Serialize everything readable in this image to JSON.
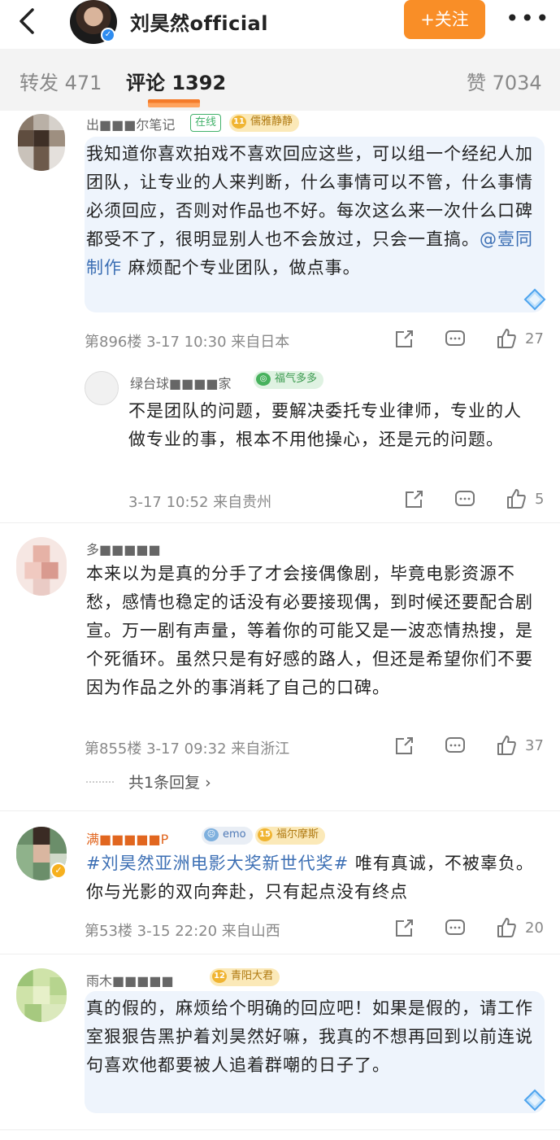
{
  "header": {
    "account_name": "刘昊然official",
    "follow_label": "+关注",
    "more_label": "•••"
  },
  "tabs": {
    "repost": "转发 471",
    "comments": "评论 1392",
    "likes": "赞 7034"
  },
  "comments": [
    {
      "username": "出■■■尔笔记",
      "online_label": "在线",
      "badge": {
        "icon": "11",
        "label": "儒雅静静"
      },
      "text_before": "我知道你喜欢拍戏不喜欢回应这些，可以组一个经纪人加团队，让专业的人来判断，什么事情可以不管，什么事情必须回应，否则对作品也不好。每次这么来一次什么口碑都受不了，很明显别人也不会放过，只会一直搞。",
      "mention": "@壹同制作",
      "text_after": " 麻烦配个专业团队，做点事。",
      "floor_time_loc": "第896楼 3-17 10:30 来自日本",
      "likes": "27",
      "reply": {
        "username": "绿台球■■■■家",
        "badge": {
          "icon": "◎",
          "label": "福气多多"
        },
        "text": "不是团队的问题，要解决委托专业律师，专业的人做专业的事，根本不用他操心，还是元的问题。",
        "time_loc": "3-17 10:52 来自贵州",
        "likes": "5"
      }
    },
    {
      "username": "多■■■■■",
      "text": "本来以为是真的分手了才会接偶像剧，毕竟电影资源不愁，感情也稳定的话没有必要接现偶，到时候还要配合剧宣。万一剧有声量，等着你的可能又是一波恋情热搜，是个死循环。虽然只是有好感的路人，但还是希望你们不要因为作品之外的事消耗了自己的口碑。",
      "floor_time_loc": "第855楼 3-17 09:32 来自浙江",
      "likes": "37",
      "replies_link": "共1条回复 ›"
    },
    {
      "username": "满■■■■■P",
      "emo_badge": "emo",
      "badge": {
        "icon": "15",
        "label": "福尔摩斯"
      },
      "hashtag": "#刘昊然亚洲电影大奖新世代奖#",
      "text_after": " 唯有真诚，不被辜负。你与光影的双向奔赴，只有起点没有终点",
      "floor_time_loc": "第53楼 3-15 22:20 来自山西",
      "likes": "20"
    },
    {
      "username": "雨木■■■■■",
      "badge": {
        "icon": "12",
        "label": "青阳大君"
      },
      "text": "真的假的，麻烦给个明确的回应吧！如果是假的，请工作室狠狠告黑护着刘昊然好嘛，我真的不想再回到以前连说句喜欢他都要被人追着群嘲的日子了。"
    }
  ],
  "colors": {
    "accent_orange": "#f98e27",
    "link_blue": "#3c6fb4",
    "bubble_bg": "#eef4fc",
    "tab_bar_bg": "#f3f3f3"
  }
}
